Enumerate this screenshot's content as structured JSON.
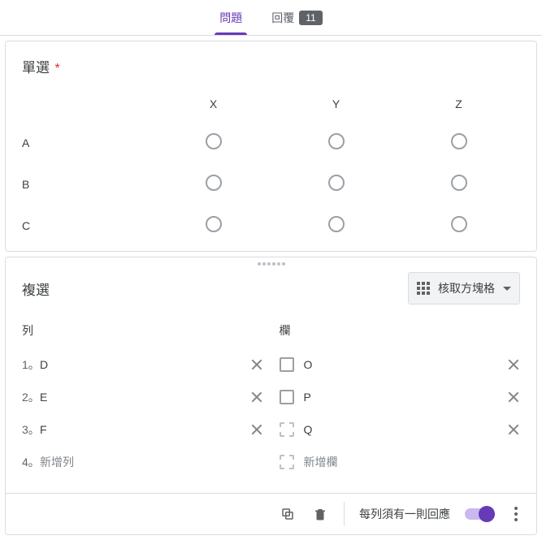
{
  "tabs": {
    "questions": "問題",
    "responses": "回覆",
    "response_count": "11"
  },
  "q1": {
    "title": "單選",
    "required_marker": "*",
    "cols": [
      "X",
      "Y",
      "Z"
    ],
    "rows": [
      "A",
      "B",
      "C"
    ]
  },
  "q2": {
    "title": "複選",
    "type_label": "核取方塊格",
    "row_header": "列",
    "col_header": "欄",
    "rows": [
      {
        "num": "1。",
        "label": "D"
      },
      {
        "num": "2。",
        "label": "E"
      },
      {
        "num": "3。",
        "label": "F"
      }
    ],
    "add_row_num": "4。",
    "add_row_label": "新增列",
    "cols": [
      "O",
      "P",
      "Q"
    ],
    "add_col_label": "新增欄"
  },
  "footer": {
    "require_label": "每列須有一則回應"
  }
}
